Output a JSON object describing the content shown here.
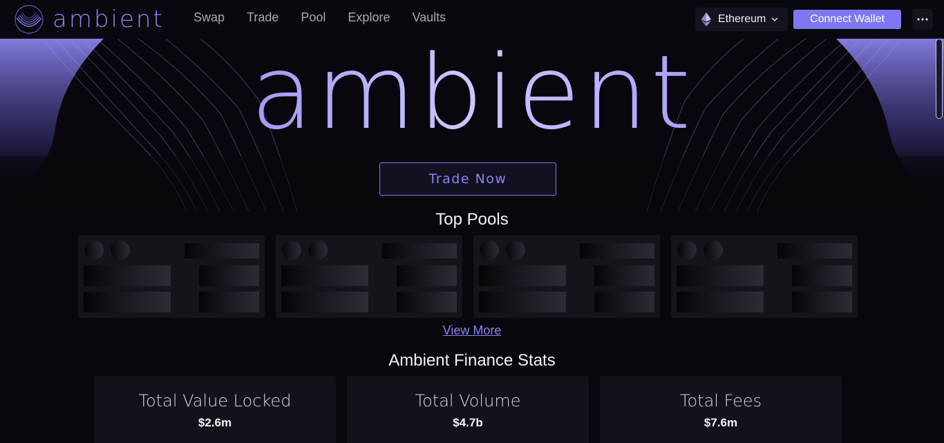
{
  "header": {
    "logo_text": "ambient",
    "nav": [
      "Swap",
      "Trade",
      "Pool",
      "Explore",
      "Vaults"
    ],
    "chain": "Ethereum",
    "connect_label": "Connect Wallet"
  },
  "hero": {
    "title": "ambient",
    "cta_label": "Trade Now"
  },
  "top_pools": {
    "title": "Top Pools",
    "card_count_visible": 4,
    "view_more_label": "View More"
  },
  "stats": {
    "title": "Ambient Finance Stats",
    "items": [
      {
        "label": "Total Value Locked",
        "value": "$2.6m"
      },
      {
        "label": "Total Volume",
        "value": "$4.7b"
      },
      {
        "label": "Total Fees",
        "value": "$7.6m"
      }
    ]
  },
  "colors": {
    "accent": "#7f77f1",
    "background": "#07070d",
    "card": "#14141b",
    "nav_text": "#a9a8b8"
  },
  "icons": {
    "logo": "ambient-ring-logo-icon",
    "chain": "ethereum-icon",
    "chain_dropdown": "chevron-down-icon",
    "more": "more-horizontal-icon"
  }
}
